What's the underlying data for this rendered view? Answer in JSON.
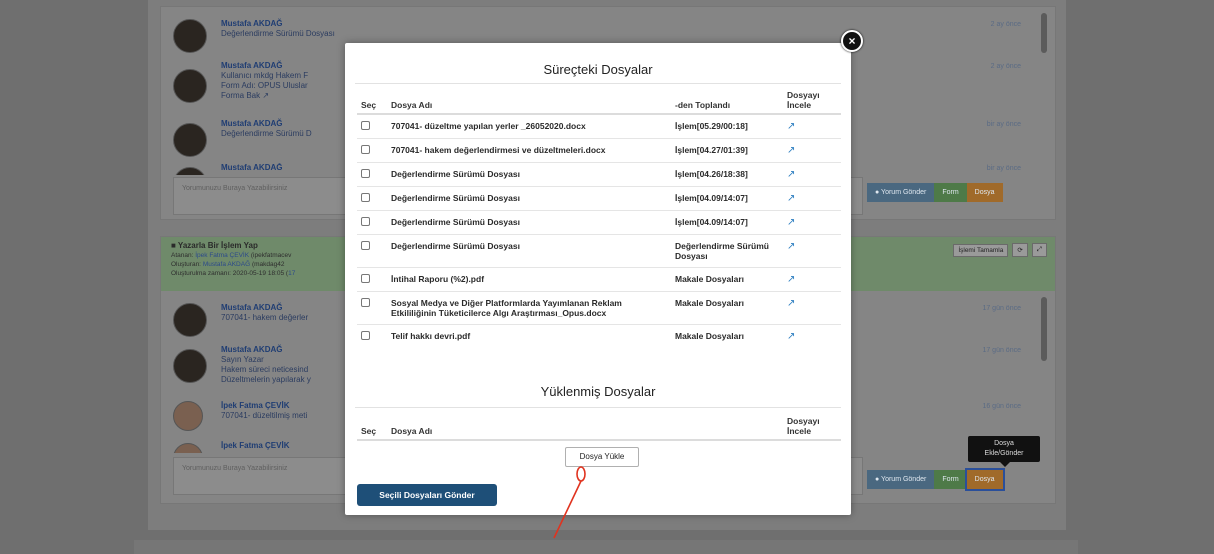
{
  "background": {
    "panel1": {
      "messages": [
        {
          "name": "Mustafa AKDAĞ",
          "lines": [
            "Değerlendirme Sürümü Dosyası"
          ],
          "time": "2 ay önce"
        },
        {
          "name": "Mustafa AKDAĞ",
          "lines": [
            "Kullanıcı mkdg Hakem F",
            "Form Adı: OPUS Uluslar"
          ],
          "link": "Forma Bak",
          "time": "2 ay önce"
        },
        {
          "name": "Mustafa AKDAĞ",
          "lines": [
            "Değerlendirme Sürümü D"
          ],
          "time": "bir ay önce"
        },
        {
          "name": "Mustafa AKDAĞ",
          "lines": [],
          "time": "bir ay önce"
        }
      ],
      "comment_placeholder": "Yorumunuzu Buraya Yazabilirsiniz",
      "buttons": {
        "comment": "Yorum Gönder",
        "form": "Form",
        "file": "Dosya"
      }
    },
    "panel2": {
      "header": {
        "title": "Yazarla Bir İşlem Yap",
        "assigned_label": "Atanan:",
        "assigned_value": "İpek Fatma ÇEVİK",
        "assigned_suffix": "(ipekfatmacev",
        "creator_label": "Oluşturan:",
        "creator_value": "Mustafa AKDAĞ",
        "creator_suffix": "(makdag42",
        "created_label": "Oluşturulma zamanı: 2020-05-19 18:05 (",
        "created_value": "17",
        "complete_button": "İşlemi Tamamla",
        "refresh_icon": "refresh-icon",
        "expand_icon": "expand-icon"
      },
      "messages": [
        {
          "name": "Mustafa AKDAĞ",
          "lines": [
            "707041- hakem değerler"
          ],
          "time": "17 gün önce"
        },
        {
          "name": "Mustafa AKDAĞ",
          "lines": [
            "Sayın Yazar",
            "Hakem süreci neticesind",
            "Düzeltmelerin yapılarak y"
          ],
          "time": "17 gün önce"
        },
        {
          "name": "İpek Fatma ÇEVİK",
          "lines": [
            "707041- düzeltilmiş meti"
          ],
          "time": "16 gün önce"
        },
        {
          "name": "İpek Fatma ÇEVİK",
          "lines": [],
          "time": ""
        }
      ],
      "comment_placeholder": "Yorumunuzu Buraya Yazabilirsiniz",
      "buttons": {
        "comment": "Yorum Gönder",
        "form": "Form",
        "file": "Dosya"
      },
      "tooltip": [
        "Dosya",
        "Ekle/Gönder"
      ]
    }
  },
  "modal": {
    "title": "Süreçteki Dosyalar",
    "columns": {
      "select": "Seç",
      "name": "Dosya Adı",
      "source": "-den Toplandı",
      "view": [
        "Dosyayı",
        "İncele"
      ]
    },
    "files": [
      {
        "name": "707041- düzeltme yapılan yerler _26052020.docx",
        "source": "İşlem[05.29/00:18]"
      },
      {
        "name": "707041- hakem değerlendirmesi ve düzeltmeleri.docx",
        "source": "İşlem[04.27/01:39]"
      },
      {
        "name": "Değerlendirme Sürümü Dosyası",
        "source": "İşlem[04.26/18:38]"
      },
      {
        "name": "Değerlendirme Sürümü Dosyası",
        "source": "İşlem[04.09/14:07]"
      },
      {
        "name": "Değerlendirme Sürümü Dosyası",
        "source": "İşlem[04.09/14:07]"
      },
      {
        "name": "Değerlendirme Sürümü Dosyası",
        "source": "Değerlendirme Sürümü Dosyası"
      },
      {
        "name": "İntihal Raporu (%2).pdf",
        "source": "Makale Dosyaları"
      },
      {
        "name": "Sosyal Medya ve Diğer Platformlarda Yayımlanan Reklam Etkililiğinin Tüketicilerce Algı Araştırması_Opus.docx",
        "source": "Makale Dosyaları"
      },
      {
        "name": "Telif hakkı devri.pdf",
        "source": "Makale Dosyaları"
      }
    ],
    "uploaded_title": "Yüklenmiş Dosyalar",
    "uploaded_columns": {
      "select": "Seç",
      "name": "Dosya Adı",
      "view": [
        "Dosyayı",
        "İncele"
      ]
    },
    "upload_button": "Dosya Yükle",
    "send_button": "Seçili Dosyaları Gönder",
    "close_symbol": "×",
    "view_icon": "external-link-icon"
  },
  "colors": {
    "overlay": "#6f6f6f",
    "primary": "#1e4f78",
    "link": "#2b7dc0",
    "annotation": "#e0331f"
  }
}
